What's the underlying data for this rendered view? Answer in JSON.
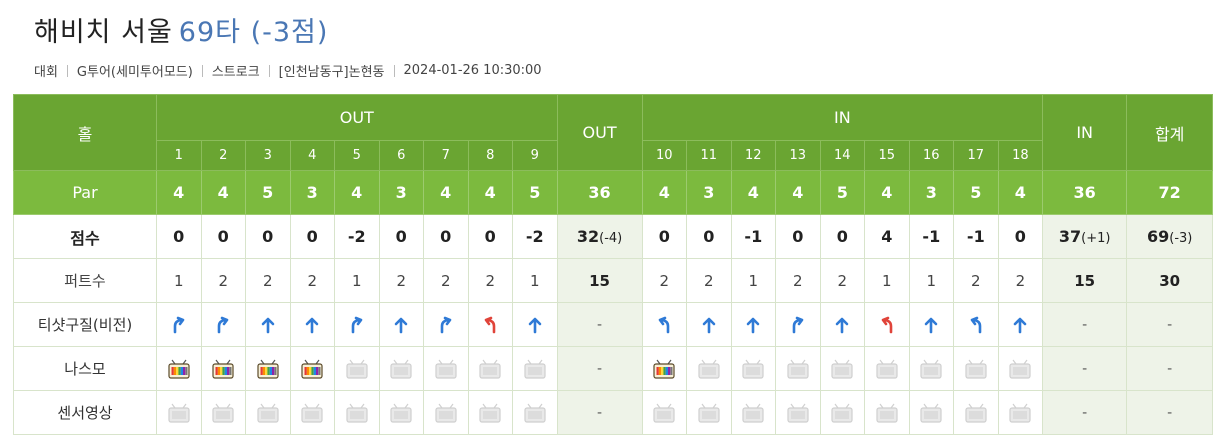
{
  "header": {
    "venue": "해비치 서울",
    "score": "69타 (-3점)"
  },
  "meta": [
    "대회",
    "G투어(세미투어모드)",
    "스트로크",
    "[인천남동구]논현동",
    "2024-01-26 10:30:00"
  ],
  "table": {
    "hole_label": "홀",
    "out_label": "OUT",
    "in_label": "IN",
    "total_label": "합계",
    "holes_out": [
      "1",
      "2",
      "3",
      "4",
      "5",
      "6",
      "7",
      "8",
      "9"
    ],
    "holes_in": [
      "10",
      "11",
      "12",
      "13",
      "14",
      "15",
      "16",
      "17",
      "18"
    ],
    "rows": {
      "par": {
        "label": "Par",
        "out": [
          "4",
          "4",
          "5",
          "3",
          "4",
          "3",
          "4",
          "4",
          "5"
        ],
        "out_total": "36",
        "in": [
          "4",
          "3",
          "4",
          "4",
          "5",
          "4",
          "3",
          "5",
          "4"
        ],
        "in_total": "36",
        "total": "72"
      },
      "score": {
        "label": "점수",
        "out": [
          "0",
          "0",
          "0",
          "0",
          "-2",
          "0",
          "0",
          "0",
          "-2"
        ],
        "out_total": "32",
        "out_total_diff": "(-4)",
        "in": [
          "0",
          "0",
          "-1",
          "0",
          "0",
          "4",
          "-1",
          "-1",
          "0"
        ],
        "in_total": "37",
        "in_total_diff": "(+1)",
        "total": "69",
        "total_diff": "(-3)"
      },
      "putts": {
        "label": "퍼트수",
        "out": [
          "1",
          "2",
          "2",
          "2",
          "1",
          "2",
          "2",
          "2",
          "1"
        ],
        "out_total": "15",
        "in": [
          "2",
          "2",
          "1",
          "2",
          "2",
          "1",
          "1",
          "2",
          "2"
        ],
        "in_total": "15",
        "total": "30"
      },
      "tee": {
        "label": "티샷구질(비전)",
        "out": [
          "right-up-blue-icon",
          "right-up-blue-icon",
          "straight-blue-icon",
          "straight-blue-icon",
          "right-up-blue-icon",
          "straight-blue-icon",
          "right-up-blue-icon",
          "left-up-red-icon",
          "straight-blue-icon"
        ],
        "out_total": "-",
        "in": [
          "left-up-blue-icon",
          "straight-blue-icon",
          "straight-blue-icon",
          "right-up-blue-icon",
          "straight-blue-icon",
          "left-up-red-icon",
          "straight-blue-icon",
          "left-up-blue-icon",
          "straight-blue-icon"
        ],
        "in_total": "-",
        "total": "-"
      },
      "nasmo": {
        "label": "나스모",
        "out": [
          true,
          true,
          true,
          true,
          false,
          false,
          false,
          false,
          false
        ],
        "out_total": "-",
        "in": [
          true,
          false,
          false,
          false,
          false,
          false,
          false,
          false,
          false
        ],
        "in_total": "-",
        "total": "-"
      },
      "sensor": {
        "label": "센서영상",
        "out": [
          false,
          false,
          false,
          false,
          false,
          false,
          false,
          false,
          false
        ],
        "out_total": "-",
        "in": [
          false,
          false,
          false,
          false,
          false,
          false,
          false,
          false,
          false
        ],
        "in_total": "-",
        "total": "-"
      }
    }
  },
  "colors": {
    "header_green": "#6aa532",
    "par_green": "#7cba3e",
    "label_bg": "#e8f0dd",
    "arrow_blue": "#2f7ad6",
    "arrow_red": "#e0443a",
    "score_blue": "#4a77b4"
  }
}
